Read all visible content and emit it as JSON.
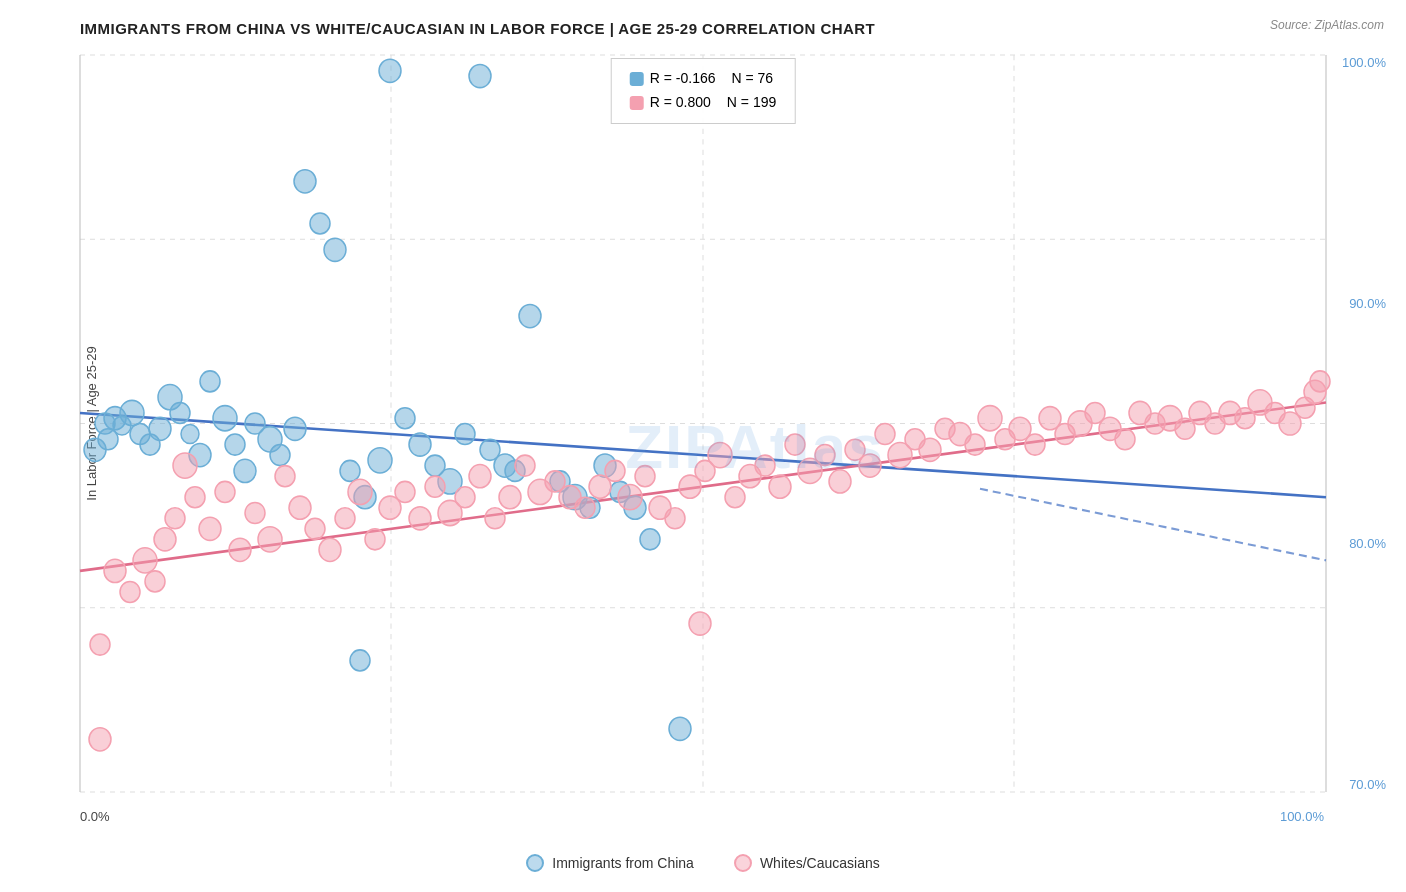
{
  "title": "IMMIGRANTS FROM CHINA VS WHITE/CAUCASIAN IN LABOR FORCE | AGE 25-29 CORRELATION CHART",
  "source": "Source: ZipAtlas.com",
  "y_axis_label": "In Labor Force | Age 25-29",
  "x_axis_left": "0.0%",
  "x_axis_right": "100.0%",
  "y_axis_values": [
    "100.0%",
    "90.0%",
    "80.0%",
    "70.0%"
  ],
  "legend_box": {
    "blue": {
      "r": "R = -0.166",
      "n": "N =  76"
    },
    "pink": {
      "r": "R =  0.800",
      "n": "N = 199"
    }
  },
  "legend": [
    {
      "id": "immigrants-china",
      "label": "Immigrants from China",
      "color": "blue"
    },
    {
      "id": "whites-caucasians",
      "label": "Whites/Caucasians",
      "color": "pink"
    }
  ],
  "watermark": "ZIPAtlas"
}
